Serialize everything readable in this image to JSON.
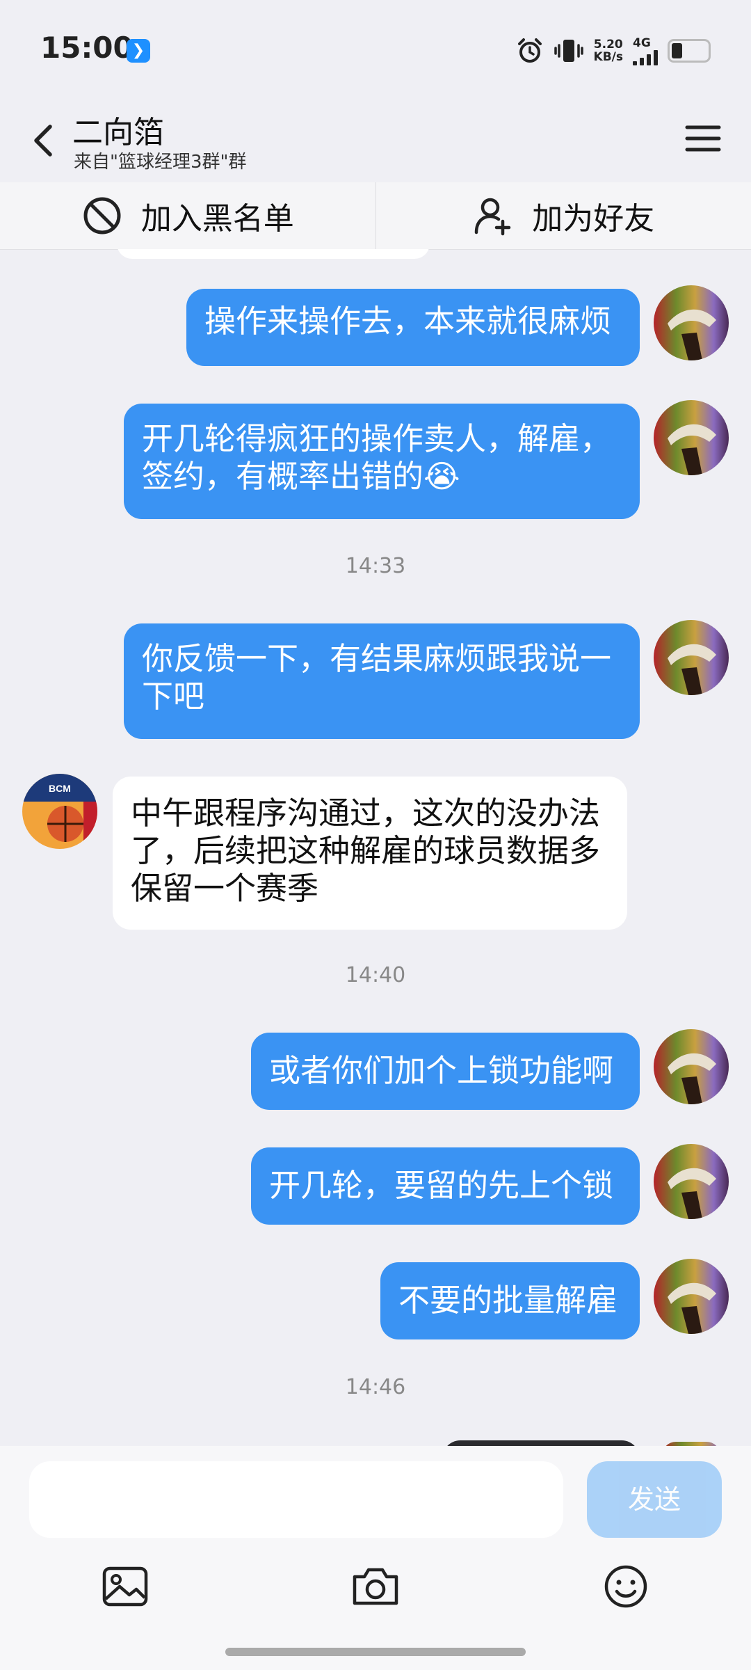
{
  "status_bar": {
    "time": "15:00",
    "net_speed_value": "5.20",
    "net_speed_unit": "KB/s",
    "network_type": "4G",
    "battery_level": 0.3,
    "icons": [
      "alarm-icon",
      "vibrate-icon",
      "signal-icon",
      "battery-icon"
    ]
  },
  "header": {
    "title": "二向箔",
    "subtitle": "来自\"篮球经理3群\"群"
  },
  "actions": {
    "block_label": "加入黑名单",
    "add_friend_label": "加为好友"
  },
  "messages": [
    {
      "sender": "me",
      "text": "操作来操作去，本来就很麻烦"
    },
    {
      "sender": "me",
      "text": "开几轮得疯狂的操作卖人，解雇，签约，有概率出错的😭"
    },
    {
      "type": "time",
      "text": "14:33"
    },
    {
      "sender": "me",
      "text": "你反馈一下，有结果麻烦跟我说一下吧"
    },
    {
      "sender": "other",
      "text": "中午跟程序沟通过，这次的没办法了，后续把这种解雇的球员数据多保留一个赛季"
    },
    {
      "type": "time",
      "text": "14:40"
    },
    {
      "sender": "me",
      "text": "或者你们加个上锁功能啊"
    },
    {
      "sender": "me",
      "text": "开几轮，要留的先上个锁"
    },
    {
      "sender": "me",
      "text": "不要的批量解雇"
    },
    {
      "type": "time",
      "text": "14:46"
    }
  ],
  "composer": {
    "input_value": "",
    "send_label": "发送"
  },
  "colors": {
    "my_bubble": "#3a93f3",
    "other_bubble": "#ffffff",
    "background": "#efeff4",
    "send_disabled": "#92c5f7"
  }
}
